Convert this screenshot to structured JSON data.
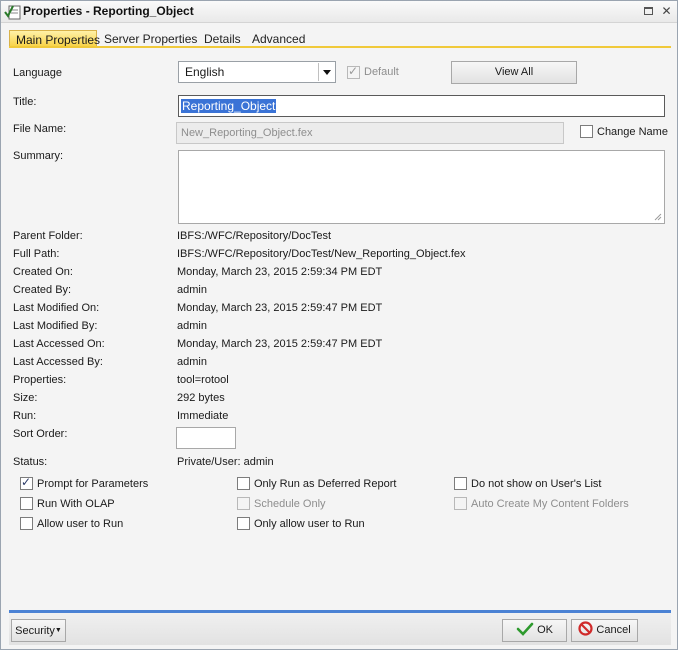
{
  "window": {
    "title": "Properties - Reporting_Object",
    "maximize_icon": "maximize-icon",
    "close_icon": "close-icon"
  },
  "tabs": [
    "Main Properties",
    "Server Properties",
    "Details",
    "Advanced"
  ],
  "active_tab": "Main Properties",
  "language": {
    "label": "Language",
    "value": "English",
    "default_label": "Default",
    "default_checked": true,
    "view_all_label": "View All"
  },
  "title_field": {
    "label": "Title:",
    "value": "Reporting_Object"
  },
  "file_name": {
    "label": "File Name:",
    "value": "New_Reporting_Object.fex",
    "change_label": "Change Name"
  },
  "summary": {
    "label": "Summary:",
    "value": ""
  },
  "details": [
    {
      "label": "Parent Folder:",
      "value": "IBFS:/WFC/Repository/DocTest"
    },
    {
      "label": "Full Path:",
      "value": "IBFS:/WFC/Repository/DocTest/New_Reporting_Object.fex"
    },
    {
      "label": "Created On:",
      "value": "Monday, March 23, 2015 2:59:34 PM EDT"
    },
    {
      "label": "Created By:",
      "value": "admin"
    },
    {
      "label": "Last Modified On:",
      "value": "Monday, March 23, 2015 2:59:47 PM EDT"
    },
    {
      "label": "Last Modified By:",
      "value": "admin"
    },
    {
      "label": "Last Accessed On:",
      "value": "Monday, March 23, 2015 2:59:47 PM EDT"
    },
    {
      "label": "Last Accessed By:",
      "value": "admin"
    },
    {
      "label": "Properties:",
      "value": "tool=rotool"
    },
    {
      "label": "Size:",
      "value": "292 bytes"
    },
    {
      "label": "Run:",
      "value": "Immediate"
    }
  ],
  "sort_order": {
    "label": "Sort Order:",
    "value": ""
  },
  "status": {
    "label": "Status:",
    "value": "Private/User: admin"
  },
  "options": [
    {
      "label": "Prompt for Parameters",
      "checked": true,
      "disabled": false
    },
    {
      "label": "Only Run as Deferred Report",
      "checked": false,
      "disabled": false
    },
    {
      "label": "Do not show on User's List",
      "checked": false,
      "disabled": false
    },
    {
      "label": "Run With OLAP",
      "checked": false,
      "disabled": false
    },
    {
      "label": "Schedule Only",
      "checked": false,
      "disabled": true
    },
    {
      "label": "Auto Create My Content Folders",
      "checked": false,
      "disabled": true
    },
    {
      "label": "Allow user to Run",
      "checked": false,
      "disabled": false
    },
    {
      "label": "Only allow user to Run",
      "checked": false,
      "disabled": false
    }
  ],
  "footer": {
    "security_label": "Security",
    "ok_label": "OK",
    "cancel_label": "Cancel"
  },
  "colors": {
    "active_tab": "#f7cf3c",
    "footer_accent": "#4b82d4",
    "ok_icon": "#2e9a2e",
    "cancel_icon": "#d02a2a"
  }
}
